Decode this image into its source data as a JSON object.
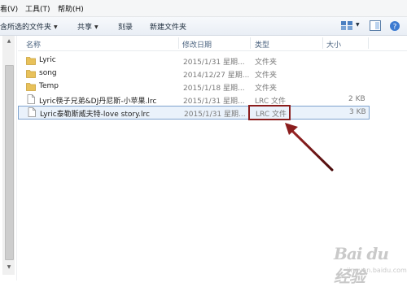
{
  "menu": {
    "view_label": "看(V)",
    "tools_label": "工具(T)",
    "help_label": "帮助(H)"
  },
  "toolbar": {
    "include_label": "含所选的文件夹",
    "share_label": "共享",
    "burn_label": "刻录",
    "new_folder_label": "新建文件夹"
  },
  "columns": {
    "name": "名称",
    "date": "修改日期",
    "type": "类型",
    "size": "大小"
  },
  "files": [
    {
      "name": "Lyric",
      "date": "2015/1/31 星期...",
      "type": "文件夹",
      "size": "",
      "kind": "folder"
    },
    {
      "name": "song",
      "date": "2014/12/27 星期...",
      "type": "文件夹",
      "size": "",
      "kind": "folder"
    },
    {
      "name": "Temp",
      "date": "2015/1/18 星期...",
      "type": "文件夹",
      "size": "",
      "kind": "folder"
    },
    {
      "name": "Lyric筷子兄弟&DJ丹尼斯-小苹果.lrc",
      "date": "2015/1/31 星期...",
      "type": "LRC 文件",
      "size": "2 KB",
      "kind": "file"
    },
    {
      "name": "Lyric泰勒斯威夫特-love story.lrc",
      "date": "2015/1/31 星期...",
      "type": "LRC 文件",
      "size": "3 KB",
      "kind": "file",
      "selected": true
    }
  ],
  "watermark": {
    "logo": "Bai du 经验",
    "url": "jingyan.baidu.com"
  },
  "colors": {
    "annotation": "#8b1d1d",
    "folder": "#e8c15a",
    "selection_border": "#7da2ce"
  }
}
